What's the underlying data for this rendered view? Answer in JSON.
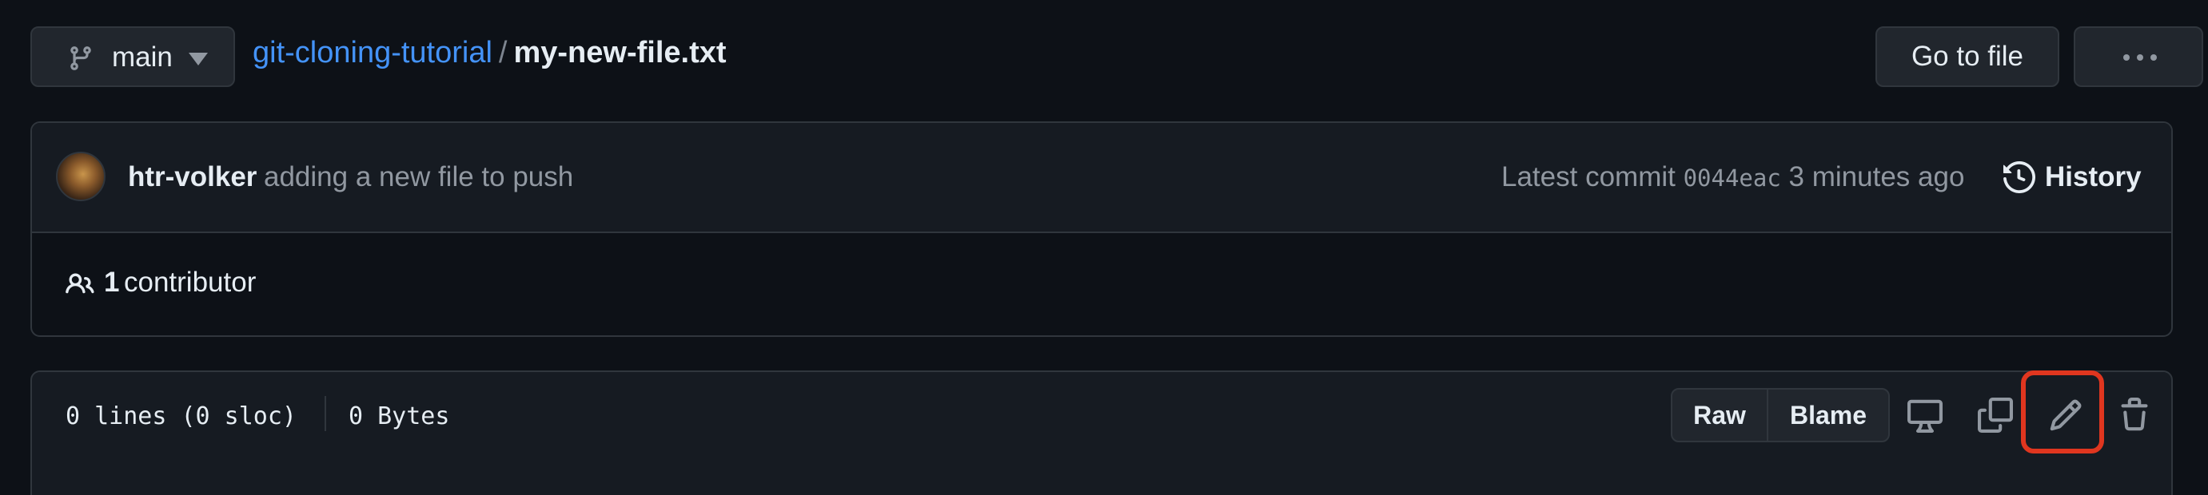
{
  "branch": {
    "name": "main"
  },
  "breadcrumb": {
    "repo": "git-cloning-tutorial",
    "separator": "/",
    "file": "my-new-file.txt"
  },
  "header_actions": {
    "goto_file": "Go to file",
    "more": "more-icon"
  },
  "commit": {
    "author": "htr-volker",
    "message": "adding a new file to push",
    "latest_prefix": "Latest commit",
    "sha": "0044eac",
    "time": "3 minutes ago",
    "history_label": "History"
  },
  "contributors": {
    "count": "1",
    "label": "contributor"
  },
  "file": {
    "lines": "0 lines (0 sloc)",
    "size": "0 Bytes",
    "raw_label": "Raw",
    "blame_label": "Blame"
  },
  "icons": {
    "branch": "git-branch-icon",
    "caret": "caret-down-icon",
    "history": "history-icon",
    "people": "people-icon",
    "display": "desktop-icon",
    "copy": "copy-icon",
    "edit": "pencil-icon",
    "delete": "trash-icon"
  },
  "colors": {
    "background": "#0d1117",
    "link": "#4493f8",
    "border": "#30363d",
    "highlight": "#e0361f"
  }
}
